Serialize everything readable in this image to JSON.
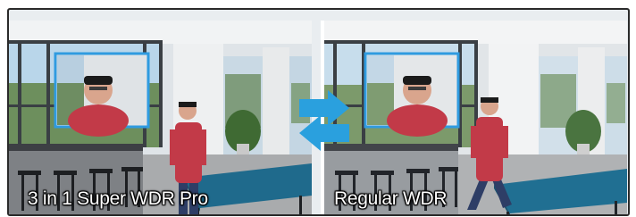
{
  "left_panel": {
    "caption": "3 in 1 Super WDR Pro"
  },
  "right_panel": {
    "caption": "Regular WDR"
  },
  "colors": {
    "accent_blue": "#2f9be0",
    "arrow_blue": "#2aa0de",
    "frame": "#2a2a2a"
  },
  "icons": {
    "compare_arrows": "double-arrow-icon"
  }
}
